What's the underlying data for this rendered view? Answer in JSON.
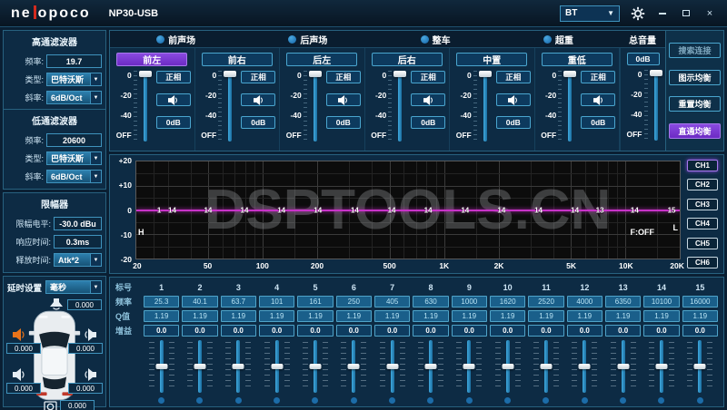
{
  "titlebar": {
    "logo_left": "ne",
    "logo_right": "opoco",
    "title": "NP30-USB",
    "connection_value": "BT",
    "dropdown_arrow": "▼",
    "close_glyph": "×"
  },
  "sidebar": {
    "hpf": {
      "title": "高通滤波器",
      "freq_label": "频率:",
      "freq_value": "19.7",
      "type_label": "类型:",
      "type_value": "巴特沃斯",
      "slope_label": "斜率:",
      "slope_value": "6dB/Oct"
    },
    "lpf": {
      "title": "低通滤波器",
      "freq_label": "频率:",
      "freq_value": "20600",
      "type_label": "类型:",
      "type_value": "巴特沃斯",
      "slope_label": "斜率:",
      "slope_value": "6dB/Oct"
    },
    "limiter": {
      "title": "限幅器",
      "level_label": "限幅电平:",
      "level_value": "-30.0 dBu",
      "attack_label": "响应时间:",
      "attack_value": "0.3ms",
      "release_label": "释放时间:",
      "release_value": "Atk*2"
    },
    "delay": {
      "label": "延时设置",
      "unit_value": "毫秒",
      "front_center": "0.000",
      "front_left": "0.000",
      "front_right": "0.000",
      "rear_left": "0.000",
      "rear_right": "0.000",
      "subwoofer": "0.000"
    }
  },
  "channel_panel": {
    "groups": [
      "前声场",
      "后声场",
      "整车",
      "超重"
    ],
    "master_label": "总音量",
    "master_gain": "0dB",
    "scale": [
      "0",
      "-20",
      "-40",
      "OFF"
    ],
    "channels": [
      {
        "name": "前左",
        "selected": true,
        "phase": "正相",
        "gain": "0dB"
      },
      {
        "name": "前右",
        "selected": false,
        "phase": "正相",
        "gain": "0dB"
      },
      {
        "name": "后左",
        "selected": false,
        "phase": "正相",
        "gain": "0dB"
      },
      {
        "name": "后右",
        "selected": false,
        "phase": "正相",
        "gain": "0dB"
      },
      {
        "name": "中置",
        "selected": false,
        "phase": "正相",
        "gain": "0dB"
      },
      {
        "name": "重低",
        "selected": false,
        "phase": "正相",
        "gain": "0dB"
      }
    ],
    "actions": [
      {
        "label": "搜索连接",
        "style": "muted"
      },
      {
        "label": "图示均衡",
        "style": "normal"
      },
      {
        "label": "重置均衡",
        "style": "normal"
      },
      {
        "label": "直通均衡",
        "style": "active"
      }
    ]
  },
  "eq_graph": {
    "watermark": "DSPTOOLS.CN",
    "filter_status": "F:OFF",
    "hpf_marker": "H",
    "lpf_marker": "L",
    "curve_db": 0,
    "y_ticks": [
      "+20",
      "+10",
      "0",
      "-10",
      "-20"
    ],
    "x_ticks": [
      {
        "label": "20",
        "f": 20
      },
      {
        "label": "50",
        "f": 50
      },
      {
        "label": "100",
        "f": 100
      },
      {
        "label": "200",
        "f": 200
      },
      {
        "label": "500",
        "f": 500
      },
      {
        "label": "1K",
        "f": 1000
      },
      {
        "label": "2K",
        "f": 2000
      },
      {
        "label": "5K",
        "f": 5000
      },
      {
        "label": "10K",
        "f": 10000
      },
      {
        "label": "20K",
        "f": 20000
      }
    ],
    "markers": [
      {
        "label": "1",
        "pos": 4.2
      },
      {
        "label": "14",
        "pos": 6.6
      },
      {
        "label": "14",
        "pos": 13.2
      },
      {
        "label": "14",
        "pos": 19.9
      },
      {
        "label": "14",
        "pos": 26.7
      },
      {
        "label": "14",
        "pos": 33.4
      },
      {
        "label": "14",
        "pos": 40.2
      },
      {
        "label": "14",
        "pos": 47.0
      },
      {
        "label": "14",
        "pos": 53.7
      },
      {
        "label": "14",
        "pos": 60.5
      },
      {
        "label": "14",
        "pos": 67.2
      },
      {
        "label": "14",
        "pos": 74.0
      },
      {
        "label": "14",
        "pos": 80.7
      },
      {
        "label": "13",
        "pos": 85.3
      },
      {
        "label": "14",
        "pos": 91.7
      },
      {
        "label": "15",
        "pos": 98.5
      }
    ],
    "channel_buttons": [
      {
        "label": "CH1",
        "active": true
      },
      {
        "label": "CH2",
        "active": false
      },
      {
        "label": "CH3",
        "active": false
      },
      {
        "label": "CH4",
        "active": false
      },
      {
        "label": "CH5",
        "active": false
      },
      {
        "label": "CH6",
        "active": false
      }
    ]
  },
  "eq_table": {
    "row_labels": {
      "index": "标号",
      "freq": "频率",
      "q": "Q值",
      "gain": "增益"
    },
    "bands": [
      {
        "index": "1",
        "freq": "25.3",
        "q": "1.19",
        "gain": "0.0"
      },
      {
        "index": "2",
        "freq": "40.1",
        "q": "1.19",
        "gain": "0.0"
      },
      {
        "index": "3",
        "freq": "63.7",
        "q": "1.19",
        "gain": "0.0"
      },
      {
        "index": "4",
        "freq": "101",
        "q": "1.19",
        "gain": "0.0"
      },
      {
        "index": "5",
        "freq": "161",
        "q": "1.19",
        "gain": "0.0"
      },
      {
        "index": "6",
        "freq": "250",
        "q": "1.19",
        "gain": "0.0"
      },
      {
        "index": "7",
        "freq": "405",
        "q": "1.19",
        "gain": "0.0"
      },
      {
        "index": "8",
        "freq": "630",
        "q": "1.19",
        "gain": "0.0"
      },
      {
        "index": "9",
        "freq": "1000",
        "q": "1.19",
        "gain": "0.0"
      },
      {
        "index": "10",
        "freq": "1620",
        "q": "1.19",
        "gain": "0.0"
      },
      {
        "index": "11",
        "freq": "2520",
        "q": "1.19",
        "gain": "0.0"
      },
      {
        "index": "12",
        "freq": "4000",
        "q": "1.19",
        "gain": "0.0"
      },
      {
        "index": "13",
        "freq": "6350",
        "q": "1.19",
        "gain": "0.0"
      },
      {
        "index": "14",
        "freq": "10100",
        "q": "1.19",
        "gain": "0.0"
      },
      {
        "index": "15",
        "freq": "16000",
        "q": "1.19",
        "gain": "0.0"
      }
    ]
  },
  "colors": {
    "accent_purple": "#7e3fd8",
    "fader_blue": "#2e9fd4",
    "magenta": "#c832c8",
    "active_speaker_orange": "#e8731a"
  }
}
